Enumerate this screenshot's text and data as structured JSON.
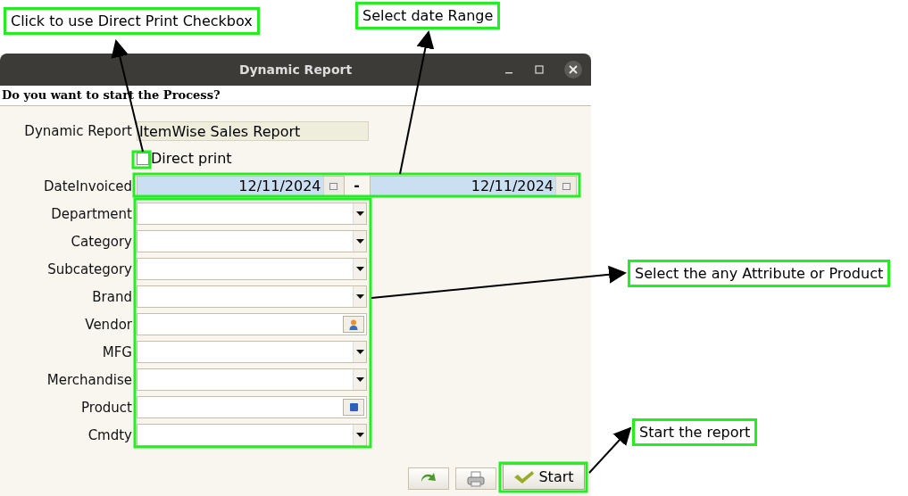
{
  "window": {
    "title": "Dynamic Report"
  },
  "prompt": "Do you want to start the Process?",
  "params": [
    {
      "kind": "text",
      "label": "Dynamic Report",
      "value": "ItemWise Sales Report"
    },
    {
      "kind": "checkbox",
      "text": "Direct print",
      "checked": false
    },
    {
      "kind": "daterange",
      "label": "DateInvoiced",
      "from": "12/11/2024",
      "separator": "-",
      "to": "12/11/2024"
    },
    {
      "kind": "select",
      "label": "Department"
    },
    {
      "kind": "select",
      "label": "Category"
    },
    {
      "kind": "select",
      "label": "Subcategory"
    },
    {
      "kind": "select",
      "label": "Brand"
    },
    {
      "kind": "partner",
      "label": "Vendor"
    },
    {
      "kind": "select",
      "label": "MFG"
    },
    {
      "kind": "select",
      "label": "Merchandise"
    },
    {
      "kind": "product",
      "label": "Product"
    },
    {
      "kind": "select",
      "label": "Cmdty"
    }
  ],
  "buttons": [
    {
      "kind": "refresh"
    },
    {
      "kind": "print"
    },
    {
      "kind": "start",
      "label": "Start"
    }
  ],
  "annotations": [
    {
      "text": "Click to use Direct Print Checkbox"
    },
    {
      "text": "Select date Range"
    },
    {
      "text": "Select the any Attribute or Product"
    },
    {
      "text": "Start the report"
    }
  ]
}
